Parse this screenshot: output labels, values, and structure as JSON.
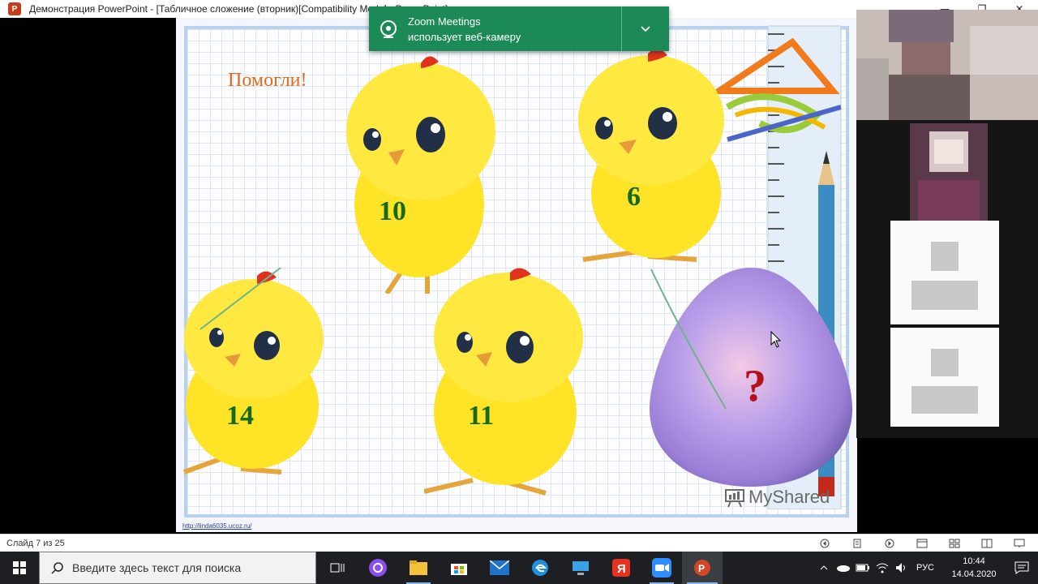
{
  "window": {
    "title": "Демонстрация PowerPoint - [Табличное сложение (вторник)[Compatibility Mode] - PowerPoint]",
    "app_icon_letter": "P",
    "controls": [
      "—",
      "❐",
      "✕"
    ]
  },
  "notification": {
    "app": "Zoom Meetings",
    "message": "использует веб-камеру"
  },
  "slide": {
    "heading": "Помогли!",
    "chicks": [
      {
        "number": "10"
      },
      {
        "number": "6"
      },
      {
        "number": "14"
      },
      {
        "number": "11"
      }
    ],
    "egg_label": "?",
    "watermark": "MyShared",
    "source_link": "http://linda6035.ucoz.ru/"
  },
  "statusbar": {
    "slide_counter": "Слайд 7 из 25"
  },
  "taskbar": {
    "search_placeholder": "Введите здесь текст для поиска",
    "language": "РУС",
    "time": "10:44",
    "date": "14.04.2020",
    "apps": [
      "task-view",
      "alice",
      "file-explorer",
      "store",
      "mail",
      "edge",
      "remote-desktop",
      "yandex",
      "zoom",
      "powerpoint"
    ]
  },
  "colors": {
    "toast_bg": "#1c8a57",
    "heading_color": "#e26a1c",
    "number_color": "#156b1a",
    "question_color": "#b3111c"
  }
}
